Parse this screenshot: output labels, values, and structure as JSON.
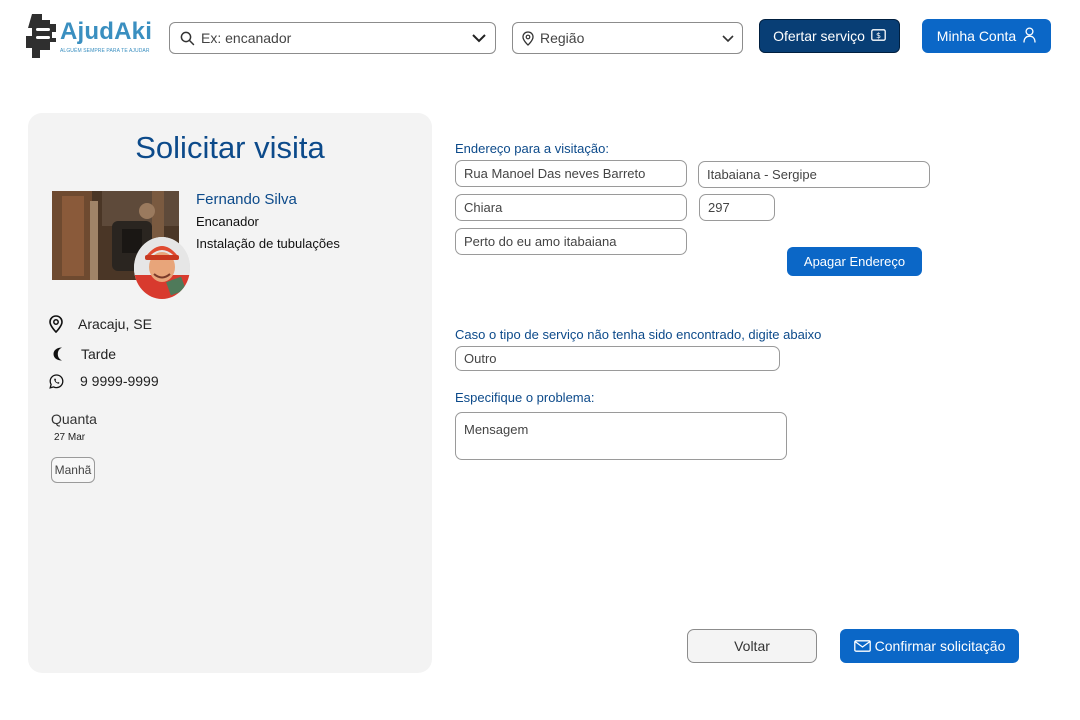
{
  "header": {
    "logo_text": "AjudAki",
    "logo_tagline": "ALGUÉM SEMPRE PARA TE AJUDAR",
    "search_placeholder": "Ex: encanador",
    "region_placeholder": "Região",
    "offer_label": "Ofertar serviço",
    "account_label": "Minha Conta"
  },
  "card": {
    "title": "Solicitar visita",
    "professional": {
      "name": "Fernando Silva",
      "role": "Encanador",
      "skill": "Instalação de tubulações"
    },
    "location": "Aracaju, SE",
    "period": "Tarde",
    "phone": "9 9999-9999",
    "schedule": {
      "day": "Quanta",
      "date": "27 Mar",
      "period_chip": "Manhã"
    }
  },
  "form": {
    "address_label": "Endereço para a visitação:",
    "street": "Rua Manoel Das neves Barreto",
    "city_state": "Itabaiana - Sergipe",
    "neighborhood": "Chiara",
    "number": "297",
    "reference": "Perto do eu amo itabaiana",
    "clear_address_label": "Apagar Endereço",
    "service_type_label": "Caso o tipo de serviço não tenha sido encontrado, digite abaixo",
    "service_type_value": "Outro",
    "problem_label": "Especifique o problema:",
    "problem_placeholder": "Mensagem"
  },
  "actions": {
    "back_label": "Voltar",
    "confirm_label": "Confirmar solicitação"
  },
  "colors": {
    "primary": "#0b67c7",
    "dark_primary": "#083e75",
    "heading": "#0c4a8a",
    "logo": "#3a8fc0",
    "card_bg": "#f3f3f3"
  },
  "icons": [
    "hand-logo-icon",
    "search-icon",
    "chevron-down-icon",
    "location-pin-icon",
    "money-icon",
    "user-icon",
    "moon-icon",
    "whatsapp-icon",
    "mail-icon"
  ]
}
